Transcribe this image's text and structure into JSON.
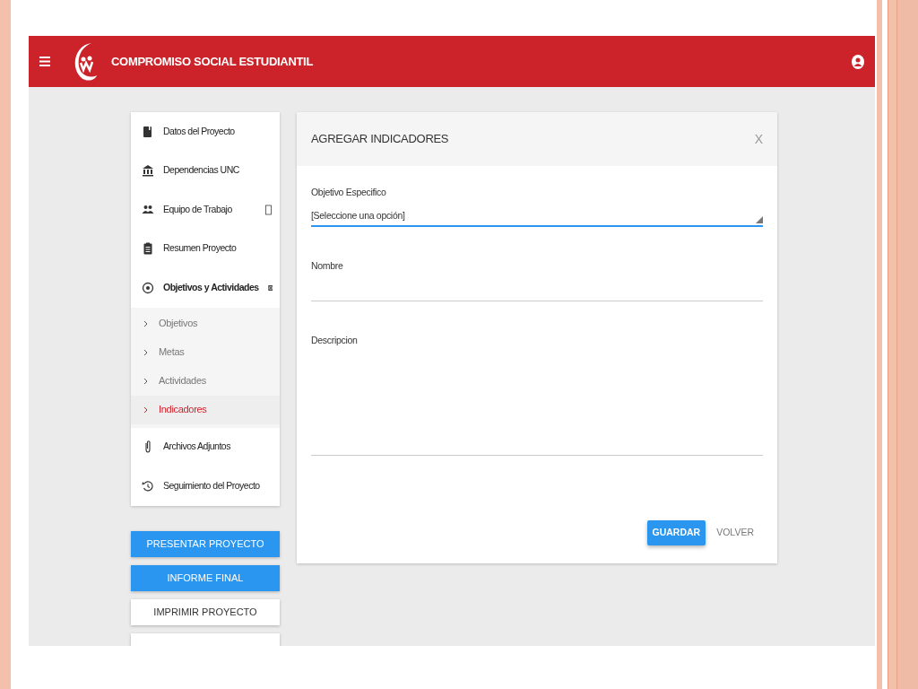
{
  "header": {
    "title": "COMPROMISO SOCIAL ESTUDIANTIL"
  },
  "sidebar": {
    "items": [
      {
        "label": "Datos del Proyecto"
      },
      {
        "label": "Dependencias UNC"
      },
      {
        "label": "Equipo de Trabajo"
      },
      {
        "label": "Resumen Proyecto"
      },
      {
        "label": "Objetivos y Actividades",
        "expanded": true,
        "children": [
          {
            "label": "Objetivos",
            "selected": false
          },
          {
            "label": "Metas",
            "selected": false
          },
          {
            "label": "Actividades",
            "selected": false
          },
          {
            "label": "Indicadores",
            "selected": true
          }
        ]
      },
      {
        "label": "Archivos Adjuntos"
      },
      {
        "label": "Seguimiento del Proyecto"
      }
    ]
  },
  "actions": [
    {
      "label": "PRESENTAR PROYECTO",
      "kind": "primary"
    },
    {
      "label": "INFORME FINAL",
      "kind": "primary"
    },
    {
      "label": "IMPRIMIR PROYECTO",
      "kind": "default"
    }
  ],
  "modal": {
    "title": "AGREGAR INDICADORES",
    "close": "X",
    "fields": [
      {
        "kind": "select",
        "label": "Objetivo Especifico",
        "value": "[Seleccione una opción]"
      },
      {
        "kind": "text",
        "label": "Nombre"
      },
      {
        "kind": "textarea",
        "label": "Descripcion"
      }
    ],
    "buttons": [
      {
        "label": "GUARDAR",
        "kind": "primary"
      },
      {
        "label": "VOLVER",
        "kind": "flat"
      }
    ]
  }
}
